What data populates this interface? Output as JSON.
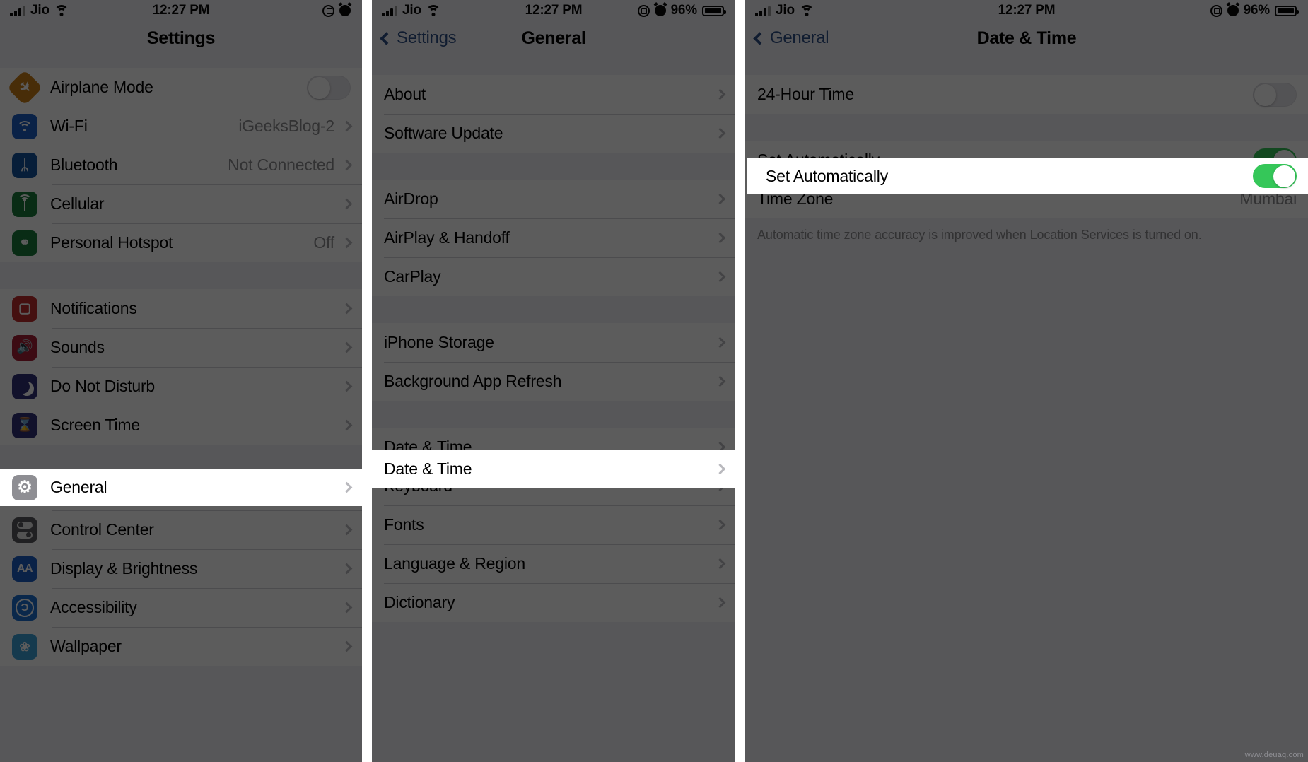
{
  "status_bar": {
    "carrier": "Jio",
    "time": "12:27 PM",
    "battery_percent": "96%",
    "wifi_icon": "wifi-icon",
    "signal_icon": "signal-bars-icon",
    "rotation_lock_icon": "rotation-lock-icon",
    "alarm_icon": "alarm-clock-icon",
    "battery_icon": "battery-icon"
  },
  "panel1": {
    "title": "Settings",
    "groups": [
      {
        "rows": [
          {
            "label": "Airplane Mode",
            "icon": "airplane-icon",
            "glyph": "✈",
            "icon_color": "#c77e17",
            "control": "toggle_off"
          },
          {
            "label": "Wi-Fi",
            "icon": "wifi-icon",
            "glyph": "",
            "icon_color": "#1d5fc4",
            "value": "iGeeksBlog-2",
            "control": "chevron"
          },
          {
            "label": "Bluetooth",
            "icon": "bluetooth-icon",
            "glyph": "ᛦ",
            "icon_color": "#14539e",
            "value": "Not Connected",
            "control": "chevron"
          },
          {
            "label": "Cellular",
            "icon": "cellular-icon",
            "glyph": "",
            "icon_color": "#1a7a3c",
            "value": "",
            "control": "chevron"
          },
          {
            "label": "Personal Hotspot",
            "icon": "hotspot-icon",
            "glyph": "⚭",
            "icon_color": "#1a7a3c",
            "value": "Off",
            "control": "chevron"
          }
        ]
      },
      {
        "rows": [
          {
            "label": "Notifications",
            "icon": "notifications-icon",
            "glyph": "▢",
            "icon_color": "#bf2d2d",
            "control": "chevron"
          },
          {
            "label": "Sounds",
            "icon": "sounds-icon",
            "glyph": "🔊",
            "icon_color": "#a61f36",
            "control": "chevron"
          },
          {
            "label": "Do Not Disturb",
            "icon": "do-not-disturb-icon",
            "glyph": "",
            "icon_color": "#2f2f78",
            "control": "chevron"
          },
          {
            "label": "Screen Time",
            "icon": "screen-time-icon",
            "glyph": "⌛",
            "icon_color": "#2f2f78",
            "control": "chevron"
          }
        ]
      },
      {
        "rows": [
          {
            "label": "General",
            "icon": "gear-icon",
            "glyph": "⚙",
            "icon_color": "#8e8e93",
            "control": "chevron",
            "highlighted": true
          },
          {
            "label": "Control Center",
            "icon": "control-center-icon",
            "glyph": "",
            "icon_color": "#5a5a5e",
            "control": "chevron"
          },
          {
            "label": "Display & Brightness",
            "icon": "display-brightness-icon",
            "glyph": "AA",
            "icon_color": "#1d5fc4",
            "control": "chevron"
          },
          {
            "label": "Accessibility",
            "icon": "accessibility-icon",
            "glyph": "Ɔ",
            "icon_color": "#1d6fd0",
            "control": "chevron"
          },
          {
            "label": "Wallpaper",
            "icon": "wallpaper-icon",
            "glyph": "❀",
            "icon_color": "#3aa0d8",
            "control": "chevron"
          }
        ]
      }
    ]
  },
  "panel2": {
    "title": "General",
    "back_label": "Settings",
    "back_icon": "chevron-left-icon",
    "groups": [
      {
        "rows": [
          {
            "label": "About",
            "control": "chevron"
          },
          {
            "label": "Software Update",
            "control": "chevron"
          }
        ]
      },
      {
        "rows": [
          {
            "label": "AirDrop",
            "control": "chevron"
          },
          {
            "label": "AirPlay & Handoff",
            "control": "chevron"
          },
          {
            "label": "CarPlay",
            "control": "chevron"
          }
        ]
      },
      {
        "rows": [
          {
            "label": "iPhone Storage",
            "control": "chevron"
          },
          {
            "label": "Background App Refresh",
            "control": "chevron"
          }
        ]
      },
      {
        "rows": [
          {
            "label": "Date & Time",
            "control": "chevron",
            "highlighted": true
          },
          {
            "label": "Keyboard",
            "control": "chevron"
          },
          {
            "label": "Fonts",
            "control": "chevron"
          },
          {
            "label": "Language & Region",
            "control": "chevron"
          },
          {
            "label": "Dictionary",
            "control": "chevron"
          }
        ]
      }
    ]
  },
  "panel3": {
    "title": "Date & Time",
    "back_label": "General",
    "back_icon": "chevron-left-icon",
    "groups": [
      {
        "rows": [
          {
            "label": "24-Hour Time",
            "control": "toggle_off"
          }
        ]
      },
      {
        "rows": [
          {
            "label": "Set Automatically",
            "control": "toggle_on",
            "highlighted": true
          },
          {
            "label": "Time Zone",
            "value": "Mumbai",
            "control": "none"
          }
        ]
      }
    ],
    "footnote": "Automatic time zone accuracy is improved when Location Services is turned on."
  },
  "watermark": "www.deuaq.com",
  "colors": {
    "toggle_on": "#35c759",
    "ios_blue": "#2e4f86",
    "dim_overlay": "rgba(0,0,0,0.64)"
  }
}
